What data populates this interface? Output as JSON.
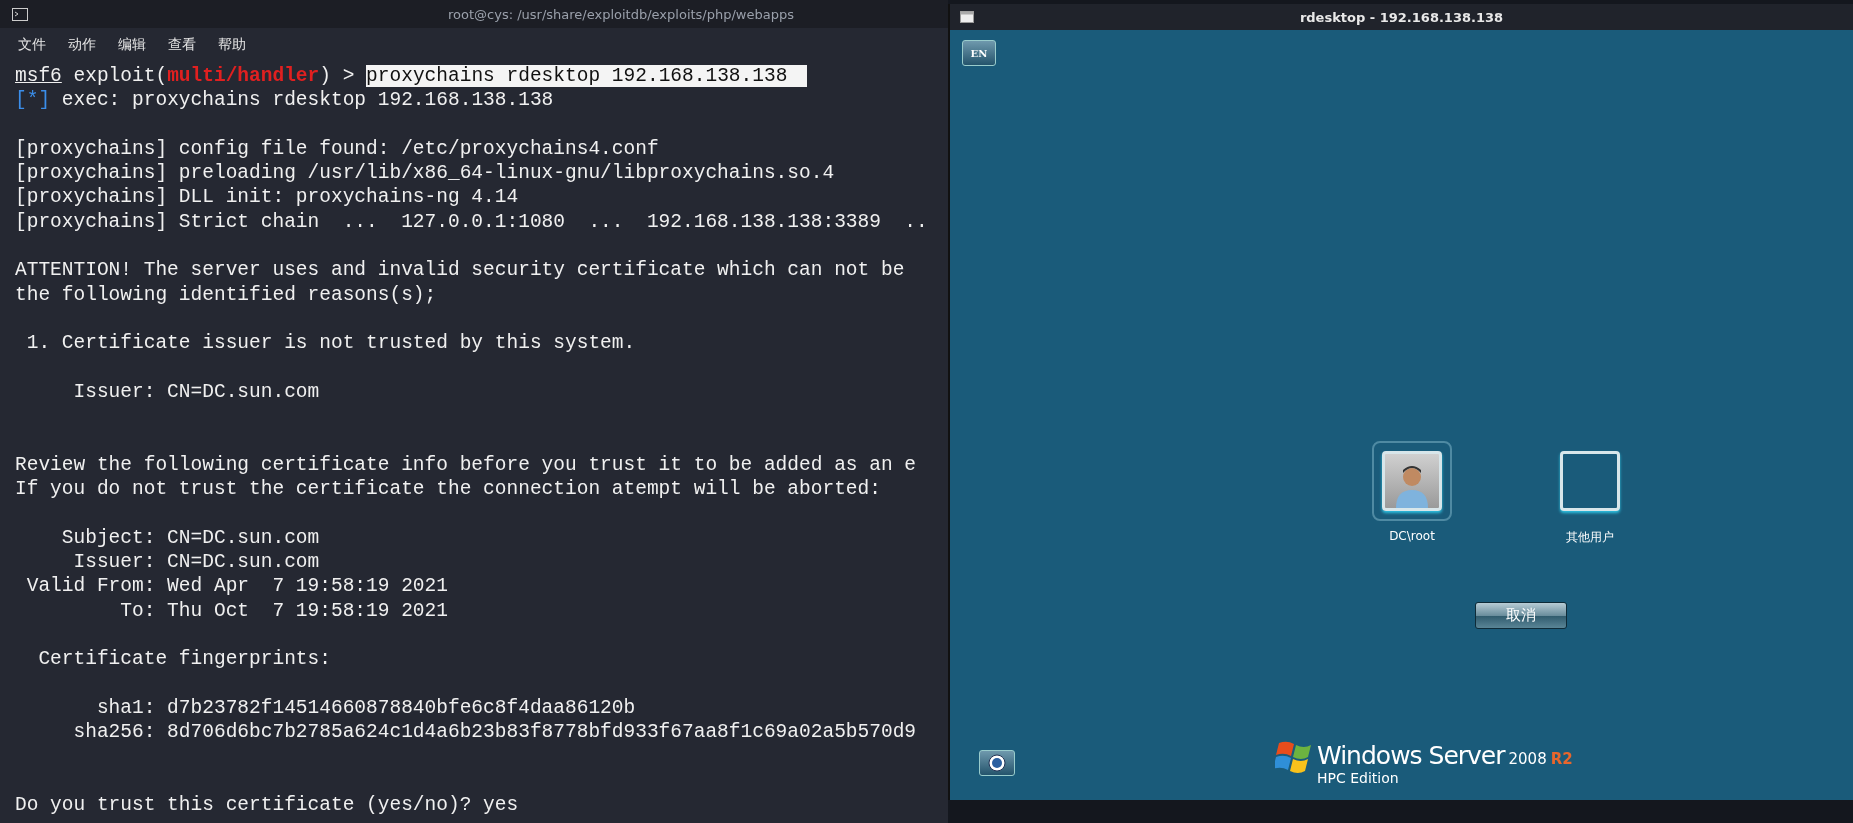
{
  "terminal": {
    "title": "root@cys: /usr/share/exploitdb/exploits/php/webapps",
    "menu": [
      "文件",
      "动作",
      "编辑",
      "查看",
      "帮助"
    ],
    "lines": [
      {
        "kind": "prompt",
        "prefix": "msf6",
        "context": "exploit(",
        "module": "multi/handler",
        "suffix": ") >",
        "command": "proxychains rdesktop 192.168.138.138"
      },
      {
        "kind": "info",
        "tag": "[*]",
        "text": "exec: proxychains rdesktop 192.168.138.138"
      },
      {
        "kind": "blank"
      },
      {
        "kind": "text",
        "text": "[proxychains] config file found: /etc/proxychains4.conf"
      },
      {
        "kind": "text",
        "text": "[proxychains] preloading /usr/lib/x86_64-linux-gnu/libproxychains.so.4"
      },
      {
        "kind": "text",
        "text": "[proxychains] DLL init: proxychains-ng 4.14"
      },
      {
        "kind": "text",
        "text": "[proxychains] Strict chain  ...  127.0.0.1:1080  ...  192.168.138.138:3389  .."
      },
      {
        "kind": "blank"
      },
      {
        "kind": "text",
        "text": "ATTENTION! The server uses and invalid security certificate which can not be"
      },
      {
        "kind": "text",
        "text": "the following identified reasons(s);"
      },
      {
        "kind": "blank"
      },
      {
        "kind": "text",
        "text": " 1. Certificate issuer is not trusted by this system."
      },
      {
        "kind": "blank"
      },
      {
        "kind": "text",
        "text": "     Issuer: CN=DC.sun.com"
      },
      {
        "kind": "blank"
      },
      {
        "kind": "blank"
      },
      {
        "kind": "text",
        "text": "Review the following certificate info before you trust it to be added as an e"
      },
      {
        "kind": "text",
        "text": "If you do not trust the certificate the connection atempt will be aborted:"
      },
      {
        "kind": "blank"
      },
      {
        "kind": "text",
        "text": "    Subject: CN=DC.sun.com"
      },
      {
        "kind": "text",
        "text": "     Issuer: CN=DC.sun.com"
      },
      {
        "kind": "text",
        "text": " Valid From: Wed Apr  7 19:58:19 2021"
      },
      {
        "kind": "text",
        "text": "         To: Thu Oct  7 19:58:19 2021"
      },
      {
        "kind": "blank"
      },
      {
        "kind": "text",
        "text": "  Certificate fingerprints:"
      },
      {
        "kind": "blank"
      },
      {
        "kind": "text",
        "text": "       sha1: d7b23782f14514660878840bfe6c8f4daa86120b"
      },
      {
        "kind": "text",
        "text": "     sha256: 8d706d6bc7b2785a624c1d4a6b23b83f8778bfd933f67aa8f1c69a02a5b570d9"
      },
      {
        "kind": "blank"
      },
      {
        "kind": "blank"
      },
      {
        "kind": "text",
        "text": "Do you trust this certificate (yes/no)? yes"
      }
    ]
  },
  "rdesktop": {
    "title": "rdesktop - 192.168.138.138",
    "language": "EN",
    "users": [
      {
        "name": "DC\\root",
        "kind": "avatar",
        "selected": true
      },
      {
        "name": "其他用户",
        "kind": "blank",
        "selected": false
      }
    ],
    "cancel": "取消",
    "logo": {
      "brand": "Windows Server",
      "version": "2008",
      "release": "R2",
      "edition": "HPC Edition"
    }
  }
}
